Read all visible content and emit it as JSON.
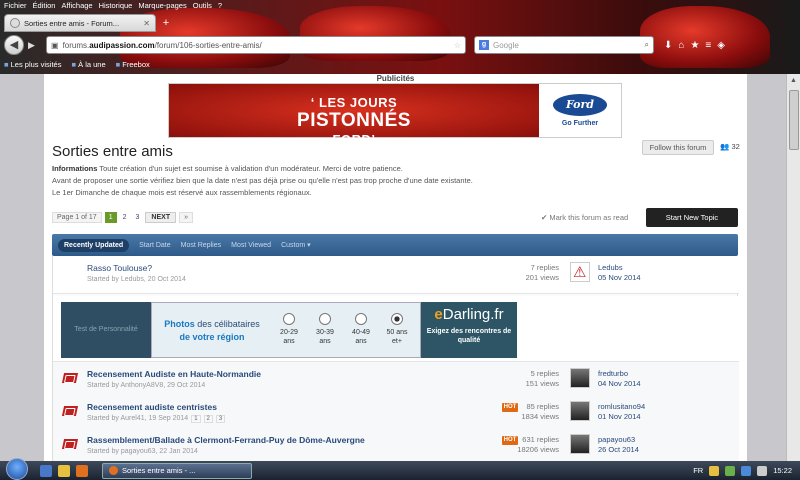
{
  "browser": {
    "menu": [
      "Fichier",
      "Édition",
      "Affichage",
      "Historique",
      "Marque-pages",
      "Outils",
      "?"
    ],
    "tab_title": "Sorties entre amis - Forum...",
    "url_prefix": "forums.",
    "url_domain": "audipassion.com",
    "url_path": "/forum/106-sorties-entre-amis/",
    "search_placeholder": "Google",
    "bookmarks": [
      "Les plus visités",
      "À la une",
      "Freebox"
    ]
  },
  "page": {
    "pub_label": "Publicités",
    "banner": {
      "line1": "‘ LES JOURS",
      "line2": "PISTONNÉS",
      "line3": "FORD’",
      "brand": "Ford",
      "tagline": "Go Further"
    },
    "forum_title": "Sorties entre amis",
    "follow_label": "Follow this forum",
    "followers": "32",
    "desc_label": "Informations",
    "desc_line1": " Toute création d'un sujet est soumise à validation d'un modérateur. Merci de votre patience.",
    "desc_line2": "Avant de proposer une sortie vérifiez bien que la date n'est pas déjà prise ou qu'elle n'est pas trop proche d'une date existante.",
    "desc_line3": "Le 1er Dimanche de chaque mois est réservé aux rassemblements régionaux.",
    "pager": {
      "label": "Page 1 of 17",
      "pages": [
        "1",
        "2",
        "3"
      ],
      "next": "NEXT",
      "last": "»"
    },
    "mark_read": "Mark this forum as read",
    "new_topic": "Start New Topic",
    "filters": [
      "Recently Updated",
      "Start Date",
      "Most Replies",
      "Most Viewed",
      "Custom ▾"
    ],
    "topics": [
      {
        "title": "Rasso Toulouse?",
        "meta": "Started by Ledubs, 20 Oct 2014",
        "replies": "7 replies",
        "views": "201 views",
        "last_user": "Ledubs",
        "last_date": "05 Nov 2014"
      },
      {
        "title": "Recensement Audiste en Haute-Normandie",
        "meta": "Started by AnthonyA8V8, 29 Oct 2014",
        "replies": "5 replies",
        "views": "151 views",
        "last_user": "fredturbo",
        "last_date": "04 Nov 2014"
      },
      {
        "title": "Recensement audiste centristes",
        "meta": "Started by Aurel41, 19 Sep 2014",
        "pages": [
          "1",
          "2",
          "3"
        ],
        "hot": "HOT",
        "replies": "85 replies",
        "views": "1834 views",
        "last_user": "romlusitano94",
        "last_date": "01 Nov 2014"
      },
      {
        "title": "Rassemblement/Ballade à Clermont-Ferrand-Puy de Dôme-Auvergne",
        "meta": "Started by pagayou63, 22 Jan 2014",
        "hot": "HOT",
        "replies": "631 replies",
        "views": "18206 views",
        "last_user": "papayou63",
        "last_date": "26 Oct 2014"
      }
    ],
    "ad": {
      "left_text": "Test de Personnalité",
      "phrase_a": "Photos",
      "phrase_b": " des célibataires",
      "phrase_c": "de votre région",
      "options": [
        "20-29 ans",
        "30-39 ans",
        "40-49 ans",
        "50 ans et+"
      ],
      "brand_a": "e",
      "brand_b": "Darling.fr",
      "sub": "Exigez des rencontres de qualité"
    }
  },
  "taskbar": {
    "task": "Sorties entre amis - ...",
    "lang": "FR",
    "time": "15:22"
  },
  "colors": {
    "accent": "#2d5a88",
    "hot": "#e06a14",
    "new_topic": "#222222"
  }
}
